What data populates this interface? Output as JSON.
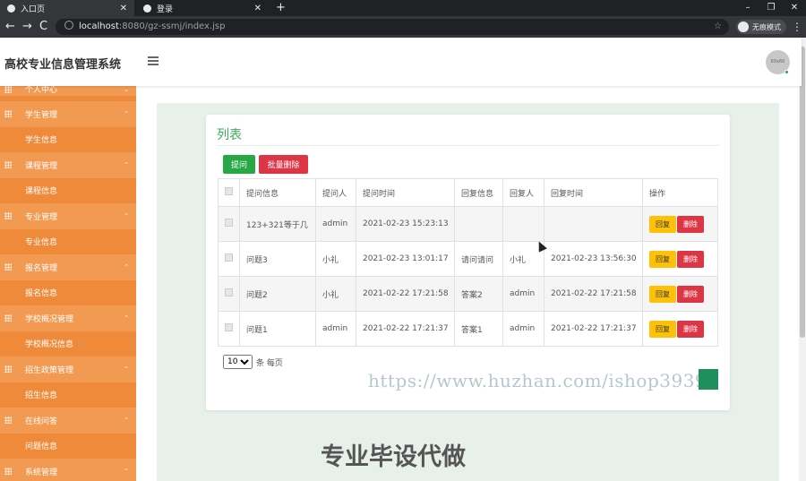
{
  "browser": {
    "tabs": [
      {
        "label": "入口页",
        "active": true
      },
      {
        "label": "登录",
        "active": false
      }
    ],
    "new_tab": "+",
    "controls": {
      "minimize": "–",
      "restore": "❐",
      "close": "✕"
    },
    "nav": {
      "back": "←",
      "forward": "→",
      "reload": "C"
    },
    "url_host": "localhost",
    "url_path": ":8080/gz-ssmj/index.jsp",
    "star": "☆",
    "incognito": "无痕模式",
    "menu": "⋮"
  },
  "header": {
    "title": "高校专业信息管理系统",
    "avatar": "60x60"
  },
  "sidebar": {
    "items": [
      {
        "label": "个人中心",
        "chevron": "⌄"
      },
      {
        "label": "学生管理",
        "chevron": "⌃",
        "sub": "学生信息"
      },
      {
        "label": "课程管理",
        "chevron": "⌃",
        "sub": "课程信息"
      },
      {
        "label": "专业管理",
        "chevron": "⌃",
        "sub": "专业信息"
      },
      {
        "label": "报名管理",
        "chevron": "⌃",
        "sub": "报名信息"
      },
      {
        "label": "学校概况管理",
        "chevron": "⌃",
        "sub": "学校概况信息"
      },
      {
        "label": "招生政策管理",
        "chevron": "⌃",
        "sub": "招生信息"
      },
      {
        "label": "在线问答",
        "chevron": "⌃",
        "sub": "问题信息"
      },
      {
        "label": "系统管理",
        "chevron": "⌃"
      }
    ]
  },
  "main": {
    "card_title": "列表",
    "buttons": {
      "ask": "提问",
      "batch_delete": "批量删除"
    },
    "table": {
      "headers": [
        "提问信息",
        "提问人",
        "提问时间",
        "回复信息",
        "回复人",
        "回复时间",
        "操作"
      ],
      "rows": [
        {
          "question": "123+321等于几",
          "asker": "admin",
          "ask_time": "2021-02-23 15:23:13",
          "reply": "",
          "replier": "",
          "reply_time": ""
        },
        {
          "question": "问题3",
          "asker": "小礼",
          "ask_time": "2021-02-23 13:01:17",
          "reply": "请问请问",
          "replier": "小礼",
          "reply_time": "2021-02-23 13:56:30"
        },
        {
          "question": "问题2",
          "asker": "小礼",
          "ask_time": "2021-02-22 17:21:58",
          "reply": "答案2",
          "replier": "admin",
          "reply_time": "2021-02-22 17:21:58"
        },
        {
          "question": "问题1",
          "asker": "admin",
          "ask_time": "2021-02-22 17:21:37",
          "reply": "答案1",
          "replier": "admin",
          "reply_time": "2021-02-22 17:21:37"
        }
      ],
      "op_reply": "回复",
      "op_delete": "删除"
    },
    "pager": {
      "page_size": "10",
      "suffix": "条 每页"
    }
  },
  "overlay": {
    "watermark": "https://www.huzhan.com/ishop39397",
    "bottom_text": "专业毕设代做"
  }
}
